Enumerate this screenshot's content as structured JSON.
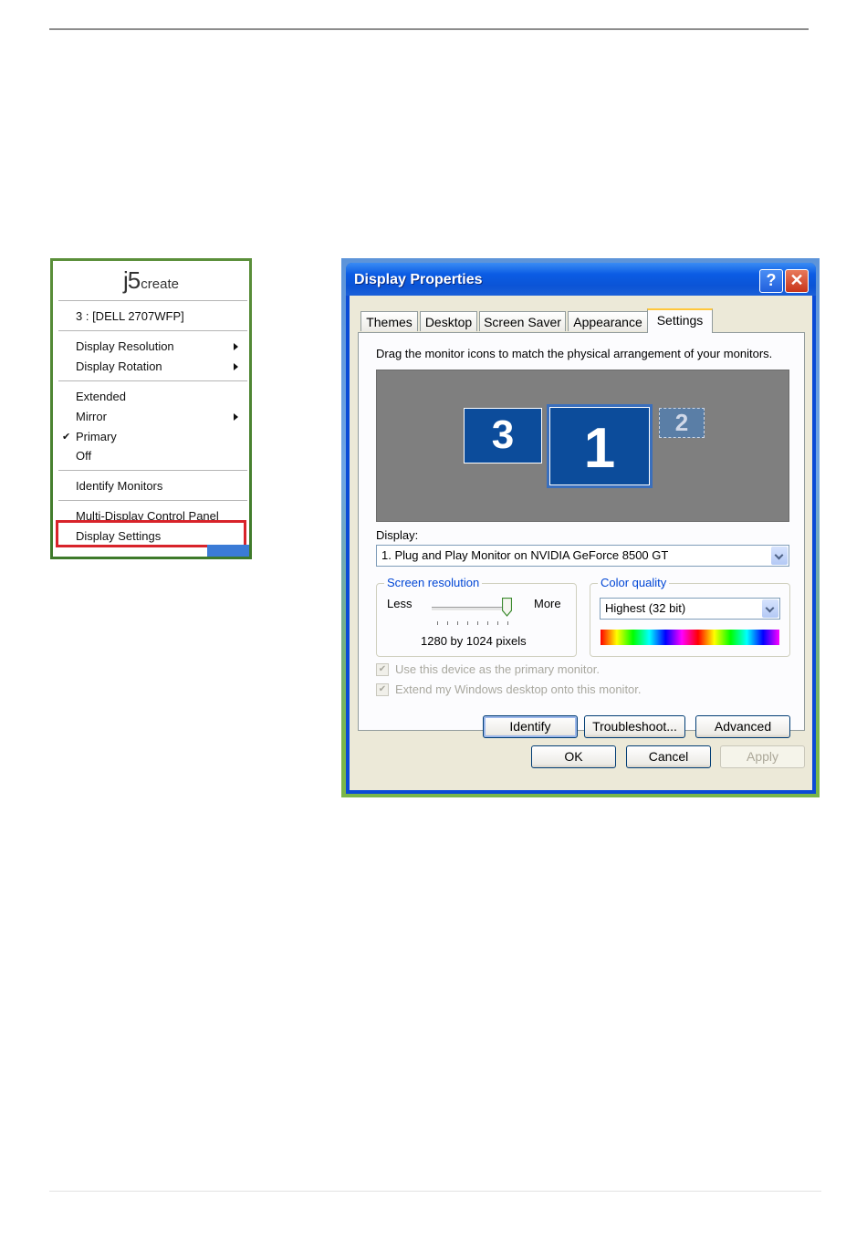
{
  "context_menu": {
    "logo": {
      "main": "j5",
      "sub": "create"
    },
    "device": "3 : [DELL 2707WFP]",
    "items": [
      {
        "label": "Display Resolution",
        "submenu": true
      },
      {
        "label": "Display Rotation",
        "submenu": true
      },
      {
        "label": "Extended",
        "submenu": false
      },
      {
        "label": "Mirror",
        "submenu": true
      },
      {
        "label": "Primary",
        "submenu": false,
        "checked": true
      },
      {
        "label": "Off",
        "submenu": false
      },
      {
        "label": "Identify Monitors",
        "submenu": false
      },
      {
        "label": "Multi-Display Control Panel",
        "submenu": false
      },
      {
        "label": "Display Settings",
        "submenu": false,
        "highlighted": true
      }
    ],
    "highlight_color": "#d8232a",
    "check_glyph": "✔",
    "arrow_icon": "chevron-right-icon"
  },
  "dialog": {
    "title": "Display Properties",
    "help_glyph": "?",
    "close_glyph": "✕",
    "tabs": [
      {
        "label": "Themes"
      },
      {
        "label": "Desktop"
      },
      {
        "label": "Screen Saver"
      },
      {
        "label": "Appearance"
      },
      {
        "label": "Settings",
        "active": true
      }
    ],
    "instruction": "Drag the monitor icons to match the physical arrangement of your monitors.",
    "monitors": [
      {
        "number": "3"
      },
      {
        "number": "1",
        "selected": true
      },
      {
        "number": "2",
        "inactive": true
      }
    ],
    "display_label": "Display:",
    "display_value": "1. Plug and Play Monitor on NVIDIA GeForce 8500 GT",
    "screen_resolution": {
      "legend": "Screen resolution",
      "less": "Less",
      "more": "More",
      "value_text": "1280 by 1024 pixels",
      "slider_position": 1.0
    },
    "color_quality": {
      "legend": "Color quality",
      "value": "Highest (32 bit)"
    },
    "checkboxes": [
      {
        "label": "Use this device as the primary monitor.",
        "checked": true,
        "disabled": true
      },
      {
        "label": "Extend my Windows desktop onto this monitor.",
        "checked": true,
        "disabled": true
      }
    ],
    "panel_buttons": {
      "identify": "Identify",
      "troubleshoot": "Troubleshoot...",
      "advanced": "Advanced"
    },
    "footer_buttons": {
      "ok": "OK",
      "cancel": "Cancel",
      "apply": "Apply"
    },
    "colors": {
      "titlebar": "#0b54d6",
      "dialog_bg": "#ece9d8",
      "monitor": "#0c4c9b",
      "accent_tab": "#ffc73c"
    }
  }
}
